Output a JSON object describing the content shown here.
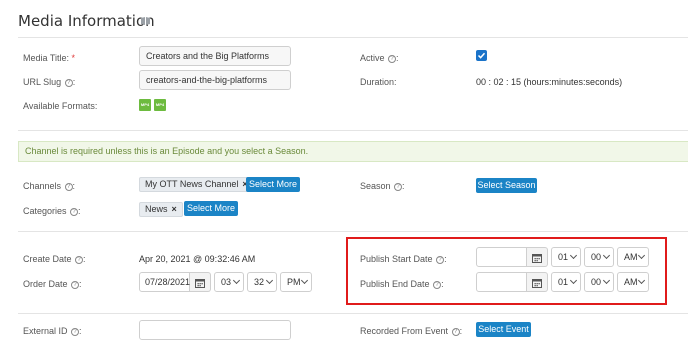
{
  "header": {
    "title": "Media Information",
    "icon": "book-icon"
  },
  "fields": {
    "media_title": {
      "label": "Media Title:",
      "required_mark": "*",
      "value": "Creators and the Big Platforms"
    },
    "url_slug": {
      "label": "URL Slug",
      "value": "creators-and-the-big-platforms"
    },
    "available_formats": {
      "label": "Available Formats:",
      "formats": [
        "MP4",
        "MP4"
      ]
    },
    "active": {
      "label": "Active",
      "checked": true
    },
    "duration": {
      "label": "Duration:",
      "value": "00 : 02 : 15 (hours:minutes:seconds)"
    }
  },
  "alert": {
    "text": "Channel is required unless this is an Episode and you select a Season."
  },
  "channels": {
    "label": "Channels",
    "tags": [
      "My OTT News Channel"
    ],
    "button": "Select More"
  },
  "categories": {
    "label": "Categories",
    "tags": [
      "News"
    ],
    "button": "Select More"
  },
  "season": {
    "label": "Season",
    "button": "Select Season"
  },
  "create_date": {
    "label": "Create Date",
    "value": "Apr 20, 2021 @ 09:32:46 AM"
  },
  "order_date": {
    "label": "Order Date",
    "date": "07/28/2021",
    "hour": "03",
    "minute": "32",
    "ampm": "PM"
  },
  "publish_start": {
    "label": "Publish Start Date",
    "date": "",
    "hour": "01",
    "minute": "00",
    "ampm": "AM"
  },
  "publish_end": {
    "label": "Publish End Date",
    "date": "",
    "hour": "01",
    "minute": "00",
    "ampm": "AM"
  },
  "external_id": {
    "label": "External ID",
    "value": ""
  },
  "recorded_from_event": {
    "label": "Recorded From Event",
    "button": "Select Event"
  },
  "colors": {
    "accent": "#1b84c6",
    "highlight_border": "#e01b1b",
    "alert_bg": "#f1f7e8",
    "format_badge": "#6dbb3f"
  }
}
